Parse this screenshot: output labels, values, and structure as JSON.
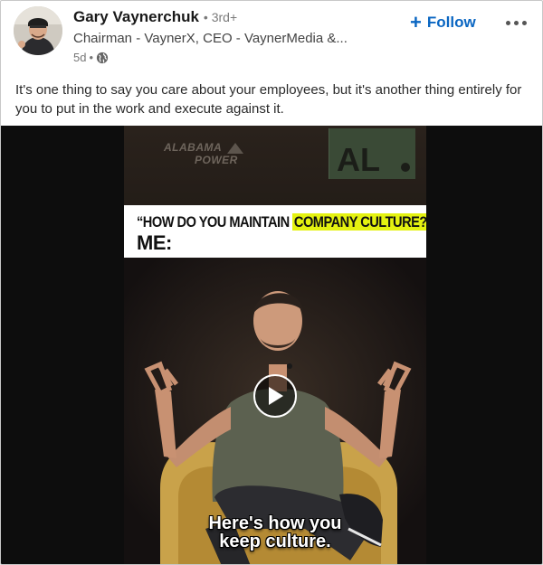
{
  "author": {
    "name": "Gary Vaynerchuk",
    "degree": "• 3rd+",
    "headline": "Chairman - VaynerX, CEO - VaynerMedia &...",
    "time": "5d",
    "visibility_icon": "globe-icon"
  },
  "actions": {
    "follow_label": "Follow",
    "more_icon": "ellipsis-icon"
  },
  "post": {
    "text": "It's one thing to say you care about your employees, but it's another thing entirely for you to put in the work and execute against it."
  },
  "video": {
    "sponsor_line1": "ALABAMA",
    "sponsor_line2": "POWER",
    "sign_text": "AL",
    "banner_prefix": "“HOW DO YOU MAINTAIN ",
    "banner_highlight": "COMPANY CULTURE?",
    "banner_suffix": "”",
    "banner_me": "ME:",
    "subtitle_line1": "Here's how you",
    "subtitle_line2": "keep culture.",
    "play_icon": "play-icon"
  },
  "colors": {
    "follow": "#0a66c2",
    "highlight": "#e4f210"
  }
}
